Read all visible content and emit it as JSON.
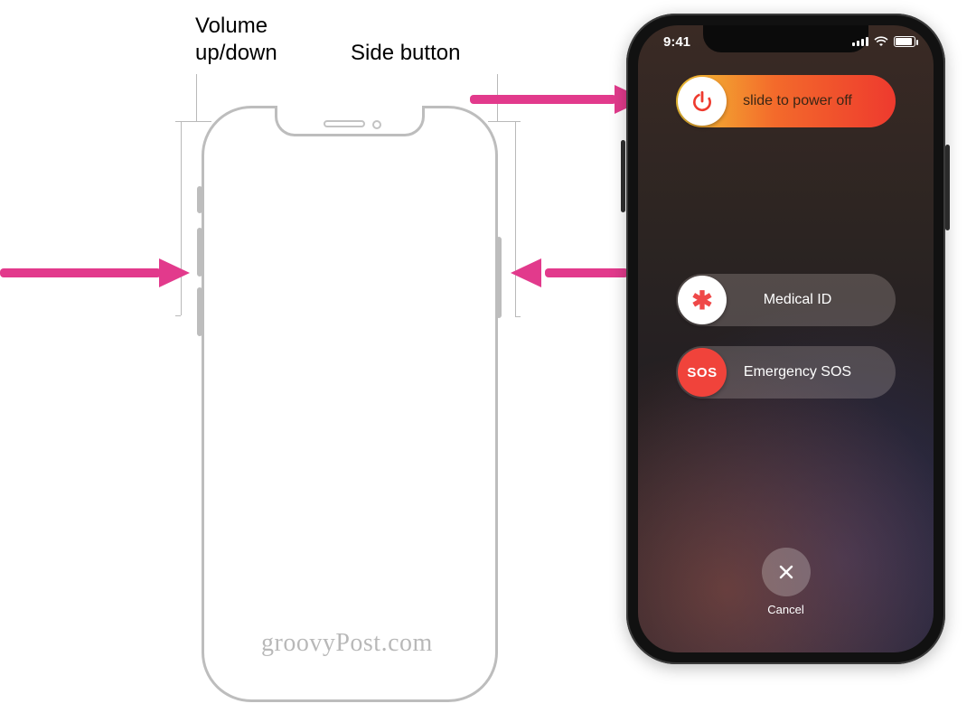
{
  "labels": {
    "volume": "Volume\nup/down",
    "side": "Side button"
  },
  "status": {
    "time": "9:41"
  },
  "sliders": {
    "power": {
      "label": "slide to power off"
    },
    "medical": {
      "label": "Medical ID",
      "knob_glyph": "✱"
    },
    "sos": {
      "label": "Emergency SOS",
      "knob_text": "SOS"
    }
  },
  "cancel": {
    "label": "Cancel"
  },
  "watermark": "groovyPost.com",
  "colors": {
    "arrow": "#e23a8c",
    "sos_red": "#f0433b",
    "medical_star": "#ef4848"
  }
}
